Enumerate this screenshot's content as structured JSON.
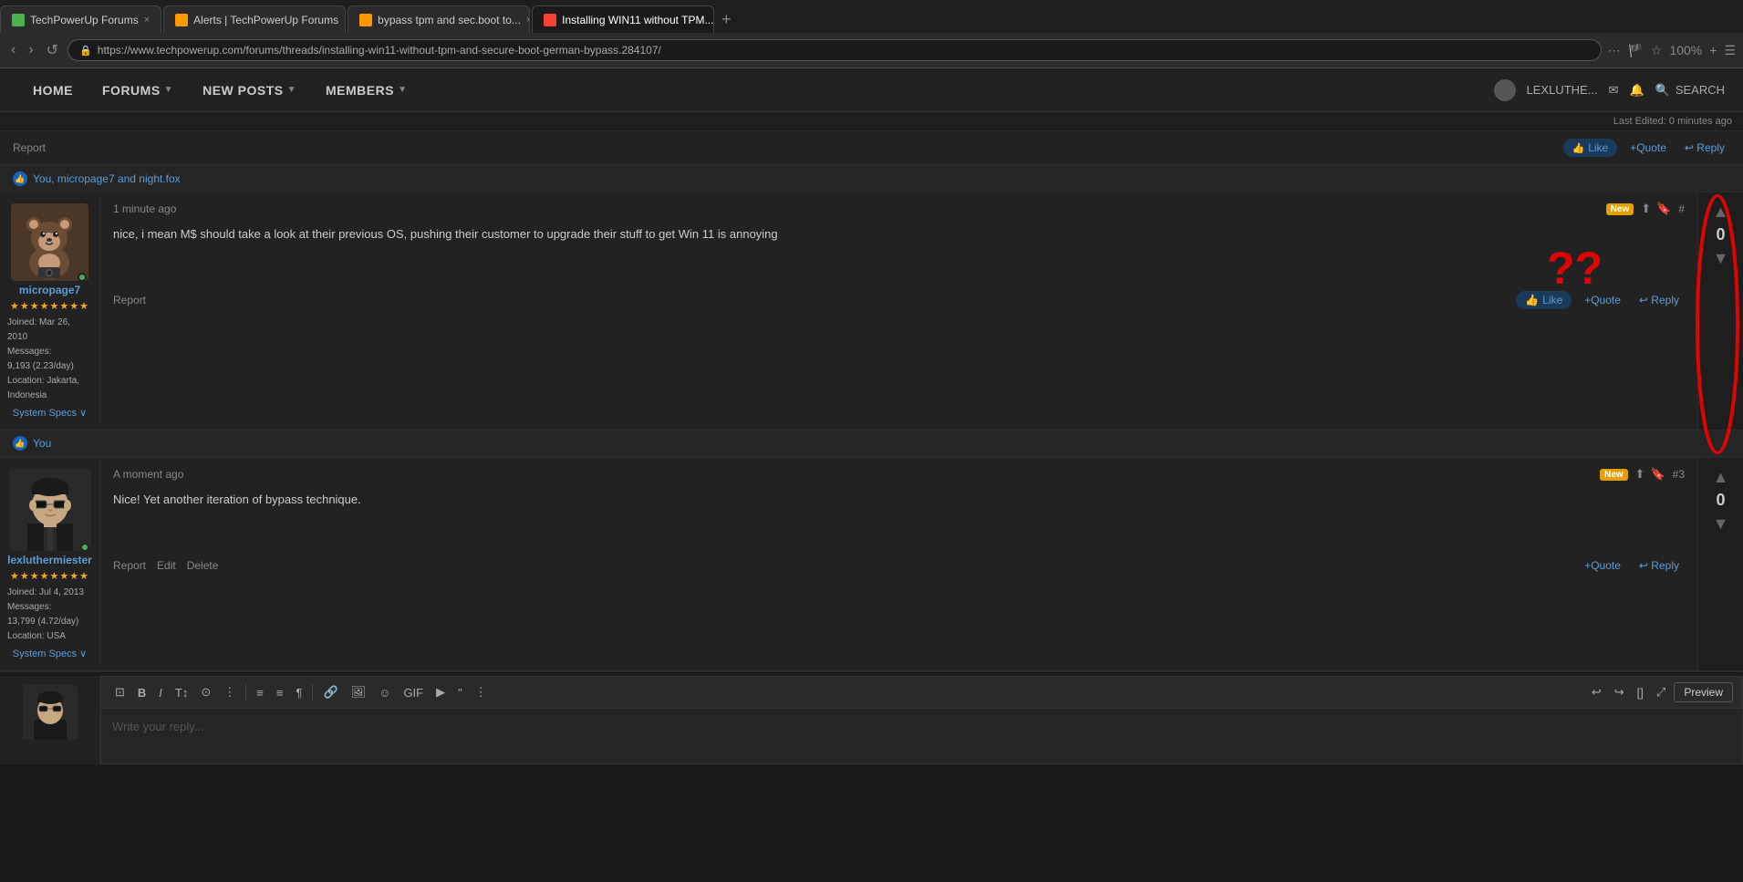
{
  "browser": {
    "tabs": [
      {
        "label": "TechPowerUp Forums",
        "active": false,
        "icon": "green",
        "close": "×"
      },
      {
        "label": "Alerts | TechPowerUp Forums",
        "active": false,
        "icon": "orange",
        "close": "×"
      },
      {
        "label": "bypass tpm and sec.boot to...",
        "active": false,
        "icon": "orange",
        "close": "×"
      },
      {
        "label": "Installing WIN11 without TPM...",
        "active": true,
        "icon": "red",
        "close": "×"
      }
    ],
    "url": "https://www.techpowerup.com/forums/threads/installing-win11-without-tpm-and-secure-boot-german-bypass.284107/",
    "zoom": "100%"
  },
  "nav": {
    "home": "HOME",
    "forums": "FORUMS",
    "new_posts": "NEW POSTS",
    "members": "MEMBERS",
    "username": "LEXLUTHE...",
    "search": "SEARCH"
  },
  "last_edited": "Last Edited: 0 minutes ago",
  "post1": {
    "report": "Report",
    "liked_by": "You, micropage7 and night.fox"
  },
  "post2": {
    "time": "1 minute ago",
    "badge": "New",
    "number": "#",
    "username": "micropage7",
    "stars": "★★★★★★★★",
    "joined_label": "Joined:",
    "joined_date": "Mar 26, 2010",
    "messages_label": "Messages:",
    "messages_count": "9,193 (2.23/day)",
    "location_label": "Location:",
    "location_val": "Jakarta, Indonesia",
    "system_specs": "System Specs ∨",
    "body": "nice, i mean M$ should take a look at their previous OS, pushing their customer to upgrade their stuff to get Win 11 is annoying",
    "report": "Report",
    "like": "Like",
    "quote": "+Quote",
    "reply": "↩ Reply",
    "vote_count": "0",
    "liked_by": "You",
    "question_marks": "??"
  },
  "post3": {
    "time": "A moment ago",
    "badge": "New",
    "number": "#3",
    "username": "lexluthermiester",
    "stars": "★★★★★★★★",
    "joined_label": "Joined:",
    "joined_date": "Jul 4, 2013",
    "messages_label": "Messages:",
    "messages_count": "13,799 (4.72/day)",
    "location_label": "Location:",
    "location_val": "USA",
    "system_specs": "System Specs ∨",
    "body": "Nice! Yet another iteration of bypass technique.",
    "report": "Report",
    "edit": "Edit",
    "delete": "Delete",
    "quote": "+Quote",
    "reply": "↩ Reply",
    "vote_count": "0"
  },
  "editor": {
    "placeholder": "Write your reply...",
    "preview": "Preview",
    "toolbar": {
      "format": "⊡",
      "bold": "B",
      "italic": "I",
      "heading": "T↕",
      "emoji2": "⊙",
      "more": "⋮",
      "list": "≡",
      "align": "≡",
      "para": "¶",
      "link": "🔗",
      "image": "🖼",
      "emoji": "☺",
      "gif": "GIF",
      "media": "▶",
      "quote_icon": "\"",
      "more2": "⋮",
      "undo": "↩",
      "redo": "↪",
      "brackets": "[]",
      "fullscreen": "⤢"
    }
  }
}
